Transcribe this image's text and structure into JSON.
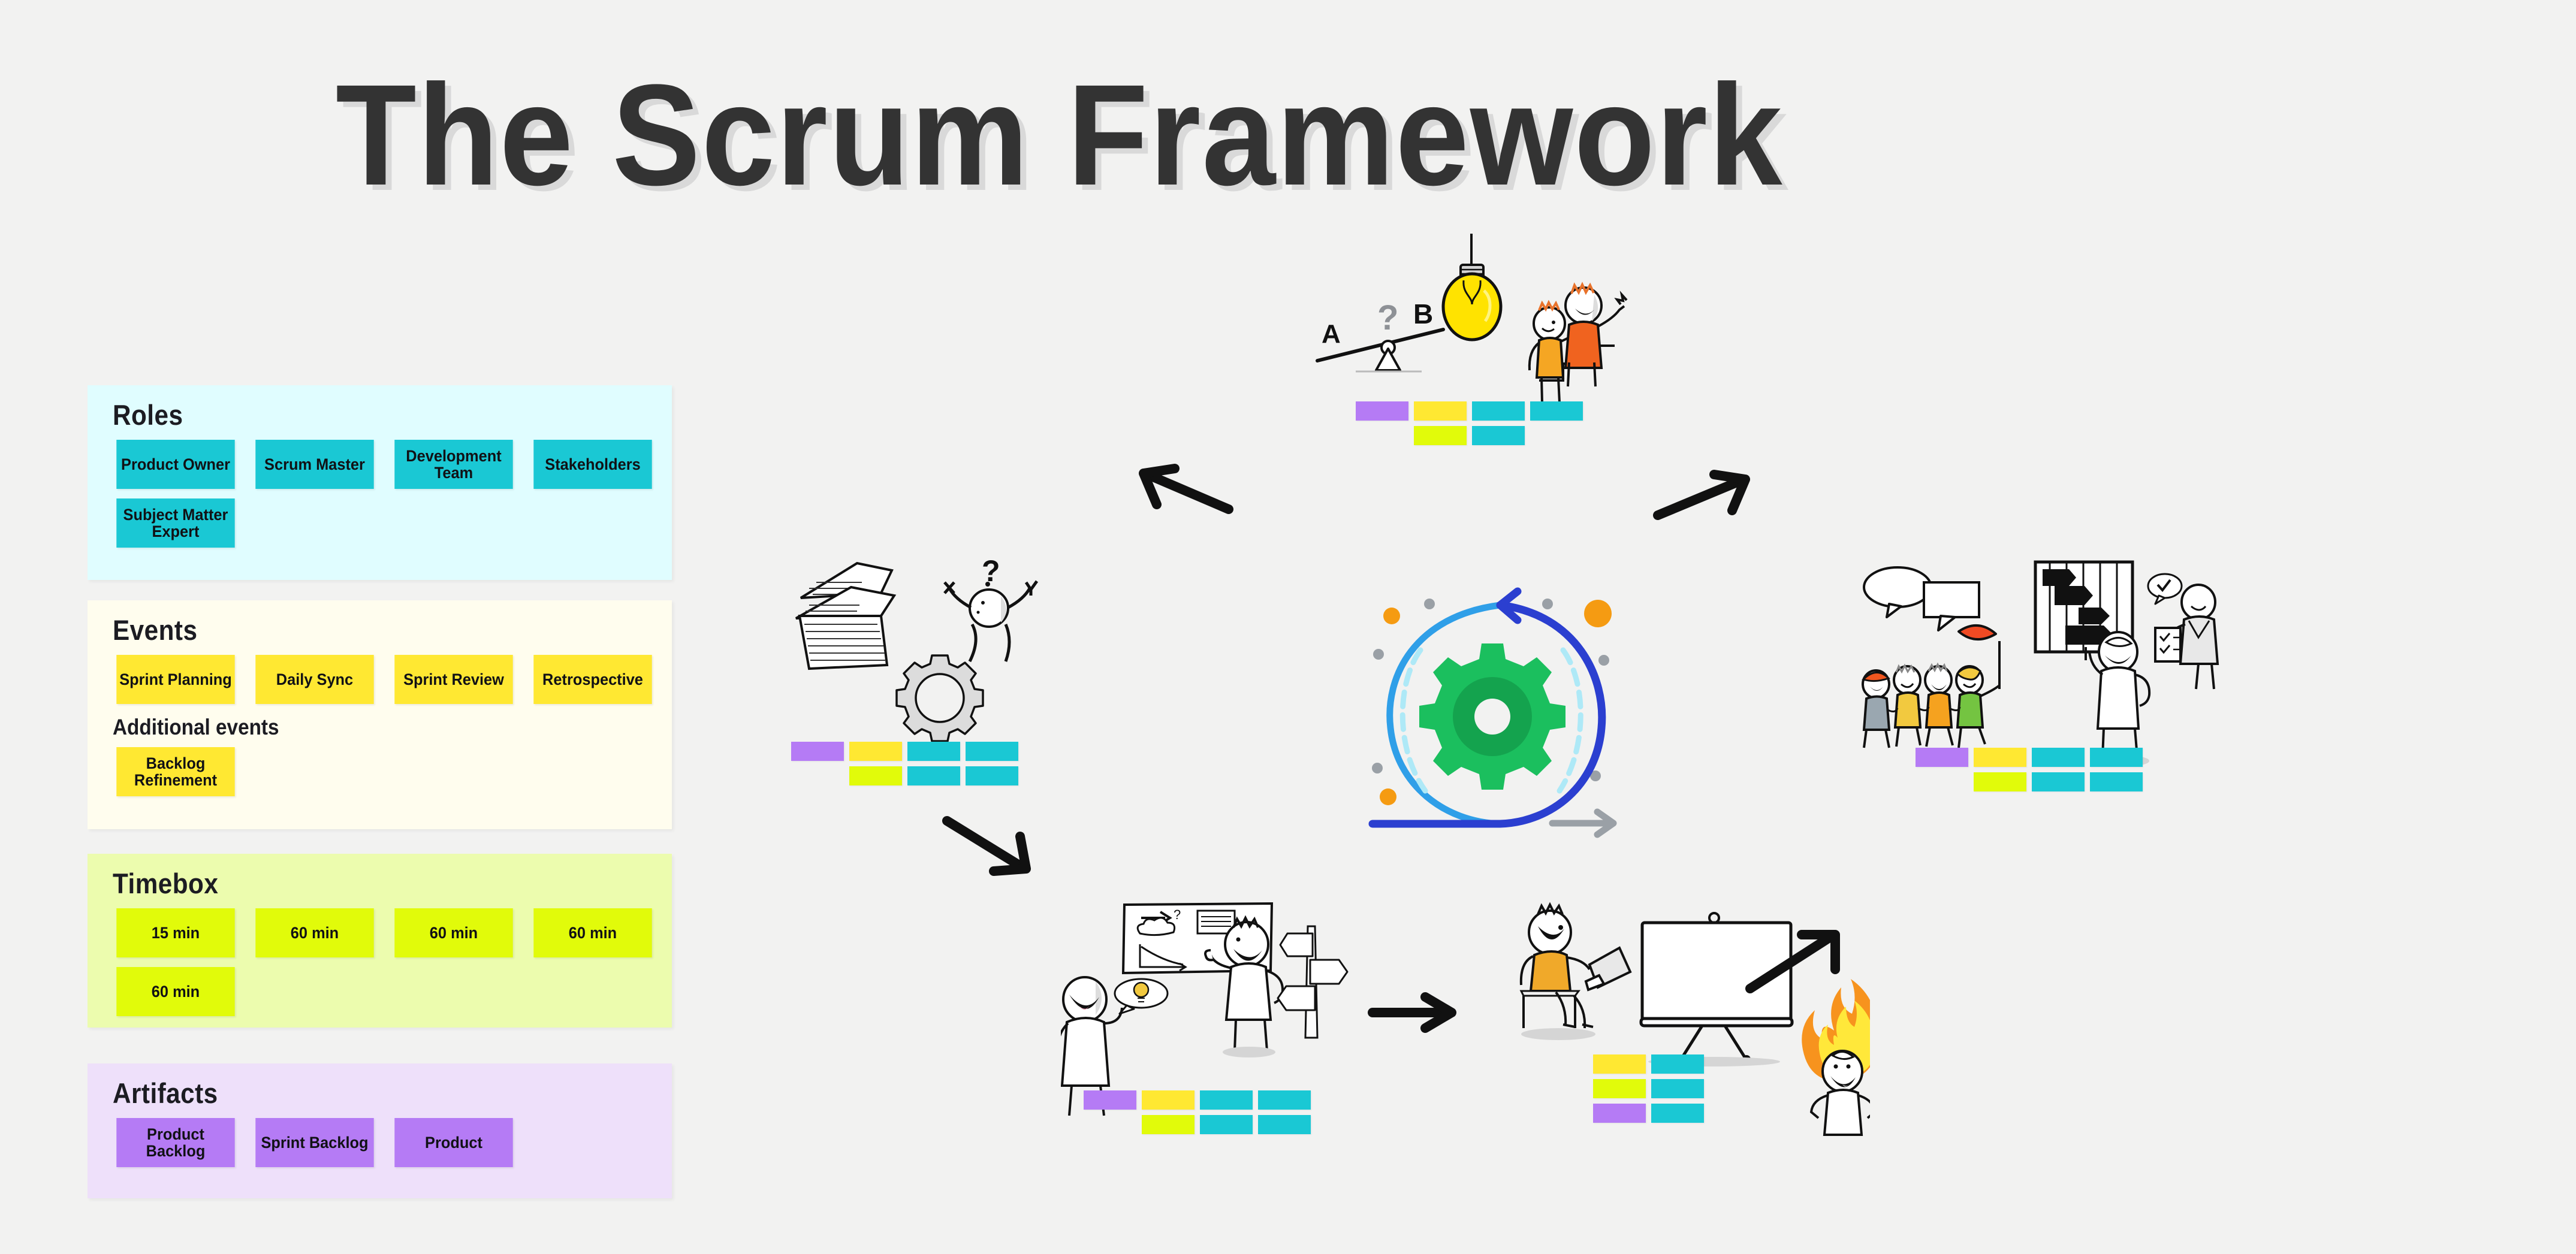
{
  "page": {
    "title": "The Scrum Framework",
    "background_color": "#f2f2f1",
    "title_color": "#333333",
    "title_shadow_color": "#d9d9d9"
  },
  "legend": {
    "panels": [
      {
        "id": "roles",
        "title": "Roles",
        "background_color": "#e0fdff",
        "chip_color": "#1ac8d4",
        "chips": [
          "Product Owner",
          "Scrum Master",
          "Development Team",
          "Stakeholders",
          "Subject Matter Expert"
        ]
      },
      {
        "id": "events",
        "title": "Events",
        "subtitle": "Additional events",
        "background_color": "#fffdee",
        "chip_color": "#ffe832",
        "chips": [
          "Sprint Planning",
          "Daily Sync",
          "Sprint Review",
          "Retrospective"
        ],
        "additional_chips": [
          "Backlog Refinement"
        ]
      },
      {
        "id": "timebox",
        "title": "Timebox",
        "background_color": "#ecfcae",
        "chip_color": "#e1fb0a",
        "chips": [
          "15 min",
          "60 min",
          "60 min",
          "60 min",
          "60 min"
        ]
      },
      {
        "id": "artifacts",
        "title": "Artifacts",
        "background_color": "#eee0fa",
        "chip_color": "#b57bf5",
        "chips": [
          "Product Backlog",
          "Sprint Backlog",
          "Product"
        ]
      }
    ]
  },
  "cycle": {
    "center": {
      "name": "sprint-iteration-gear",
      "gear_color": "#1bbf5e",
      "loop_color": "#2b3fd0",
      "loop_accent_color": "#2f9fe8",
      "dot_colors": [
        "#f59b12",
        "#9aa0a6"
      ]
    },
    "stages": [
      {
        "id": "backlog-refinement",
        "position": "left",
        "icons": [
          "document-stack-icon",
          "confused-person-icon",
          "gear-outline-icon"
        ],
        "tags": [
          [
            "purple",
            "yellow",
            "cyan",
            "cyan"
          ],
          [
            "empty",
            "lime",
            "cyan",
            "cyan"
          ]
        ]
      },
      {
        "id": "sprint-planning",
        "position": "top",
        "icons": [
          "lightbulb-icon",
          "seesaw-ab-icon",
          "team-climbing-steps-icon"
        ],
        "labels": [
          "A",
          "B",
          "?"
        ],
        "tags": [
          [
            "purple",
            "yellow",
            "cyan",
            "cyan"
          ],
          [
            "empty",
            "lime",
            "cyan",
            "empty"
          ]
        ]
      },
      {
        "id": "retrospective",
        "position": "right",
        "icons": [
          "speech-bubbles-icon",
          "team-with-flag-icon",
          "gantt-chart-icon",
          "checklist-person-icon"
        ],
        "tags": [
          [
            "purple",
            "yellow",
            "cyan",
            "cyan"
          ],
          [
            "empty",
            "lime",
            "cyan",
            "cyan"
          ]
        ]
      },
      {
        "id": "daily-sync",
        "position": "bottom-left",
        "icons": [
          "whiteboard-burndown-icon",
          "idea-bubble-person-icon",
          "signpost-icon"
        ],
        "tags": [
          [
            "purple",
            "yellow",
            "cyan",
            "cyan"
          ],
          [
            "empty",
            "lime",
            "cyan",
            "cyan"
          ]
        ]
      },
      {
        "id": "sprint-review",
        "position": "bottom-center",
        "icons": [
          "person-with-laptop-icon",
          "presentation-screen-icon",
          "person-on-fire-icon"
        ],
        "tags": [
          [
            "yellow",
            "cyan"
          ],
          [
            "lime",
            "cyan"
          ],
          [
            "purple",
            "cyan"
          ]
        ]
      }
    ],
    "arrows": [
      {
        "id": "arrow-top-left",
        "direction": "down-left"
      },
      {
        "id": "arrow-top-right",
        "direction": "down-right"
      },
      {
        "id": "arrow-left-down",
        "direction": "down-right"
      },
      {
        "id": "arrow-bottom-middle",
        "direction": "right"
      },
      {
        "id": "arrow-bottom-right",
        "direction": "up-right"
      }
    ]
  }
}
